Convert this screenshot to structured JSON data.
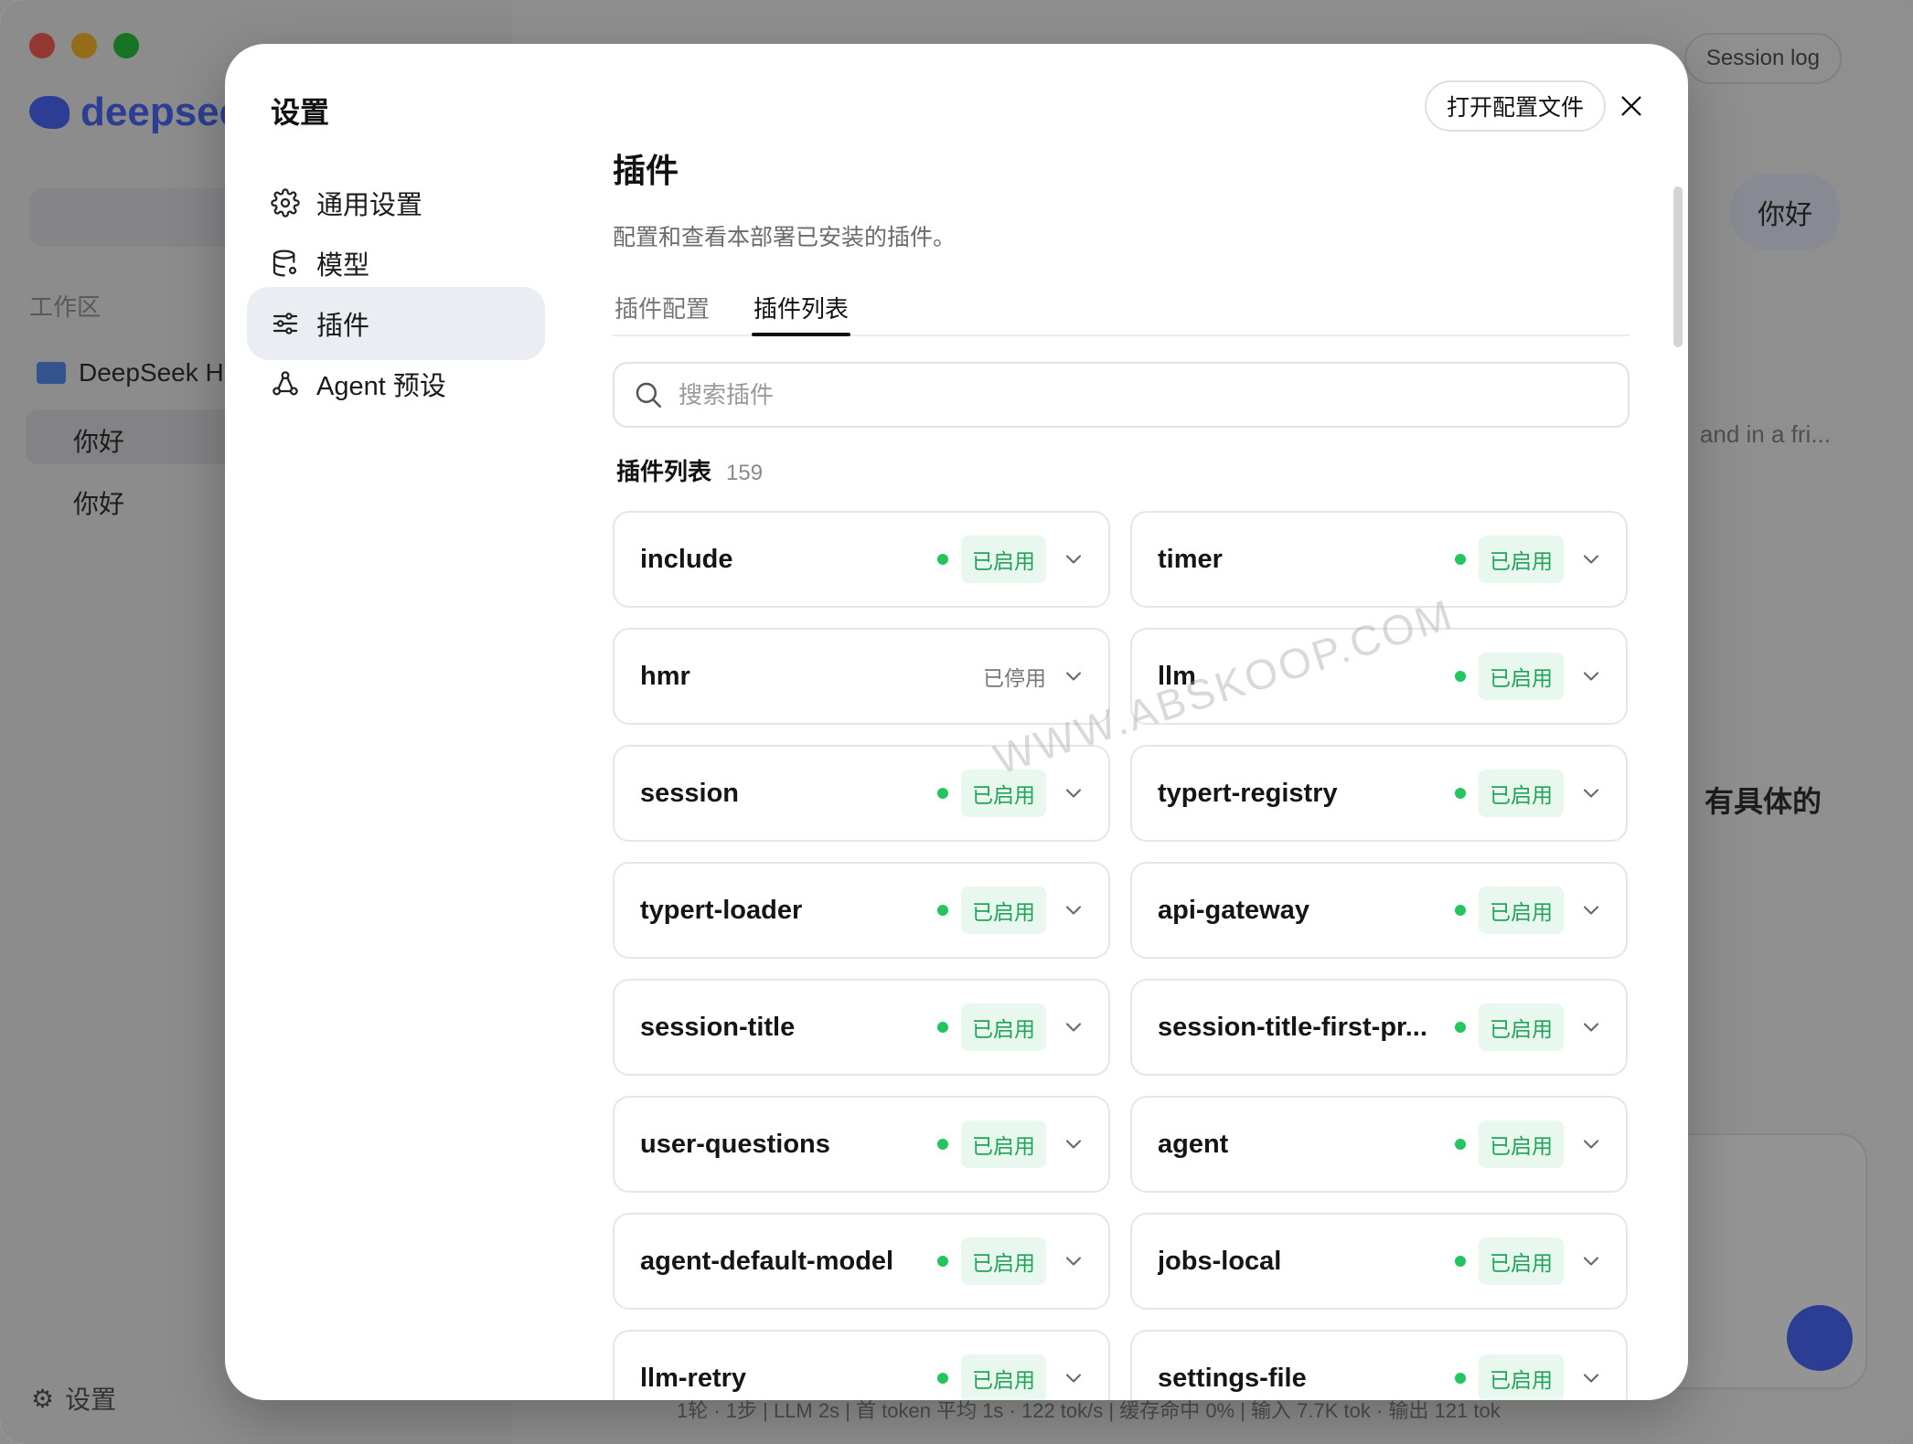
{
  "background": {
    "logo_text": "deepseek",
    "section_label": "工作区",
    "folder_label": "DeepSeek H",
    "chats": [
      "你好",
      "你好"
    ],
    "settings_label": "设置",
    "session_log": "Session log",
    "user_bubble": "你好",
    "assistant_snippet": "and in a fri...",
    "assistant_heading": "有具体的",
    "status_line": "1轮 · 1步 | LLM 2s | 首 token 平均 1s · 122 tok/s | 缓存命中 0% | 输入 7.7K tok · 输出 121 tok"
  },
  "modal": {
    "title": "设置",
    "open_config_label": "打开配置文件",
    "nav": [
      {
        "label": "通用设置",
        "icon": "gear-icon"
      },
      {
        "label": "模型",
        "icon": "database-icon"
      },
      {
        "label": "插件",
        "icon": "sliders-icon"
      },
      {
        "label": "Agent 预设",
        "icon": "agent-icon"
      }
    ],
    "active_nav": "插件"
  },
  "content": {
    "title": "插件",
    "description": "配置和查看本部署已安装的插件。",
    "tabs": [
      "插件配置",
      "插件列表"
    ],
    "active_tab": "插件列表",
    "search_placeholder": "搜索插件",
    "list_label": "插件列表",
    "list_count": "159"
  },
  "plugins": [
    {
      "name": "include",
      "status": "已启用",
      "enabled": true
    },
    {
      "name": "timer",
      "status": "已启用",
      "enabled": true
    },
    {
      "name": "hmr",
      "status": "已停用",
      "enabled": false
    },
    {
      "name": "llm",
      "status": "已启用",
      "enabled": true
    },
    {
      "name": "session",
      "status": "已启用",
      "enabled": true
    },
    {
      "name": "typert-registry",
      "status": "已启用",
      "enabled": true
    },
    {
      "name": "typert-loader",
      "status": "已启用",
      "enabled": true
    },
    {
      "name": "api-gateway",
      "status": "已启用",
      "enabled": true
    },
    {
      "name": "session-title",
      "status": "已启用",
      "enabled": true
    },
    {
      "name": "session-title-first-pr...",
      "status": "已启用",
      "enabled": true
    },
    {
      "name": "user-questions",
      "status": "已启用",
      "enabled": true
    },
    {
      "name": "agent",
      "status": "已启用",
      "enabled": true
    },
    {
      "name": "agent-default-model",
      "status": "已启用",
      "enabled": true
    },
    {
      "name": "jobs-local",
      "status": "已启用",
      "enabled": true
    },
    {
      "name": "llm-retry",
      "status": "已启用",
      "enabled": true
    },
    {
      "name": "settings-file",
      "status": "已启用",
      "enabled": true
    }
  ],
  "watermark": "WWW.ABSKOOP.COM",
  "colors": {
    "enabled_green": "#22c55e",
    "badge_bg": "#e8f8ee",
    "active_nav_bg": "#eaedf2",
    "brand_blue": "#4d6bfe"
  }
}
